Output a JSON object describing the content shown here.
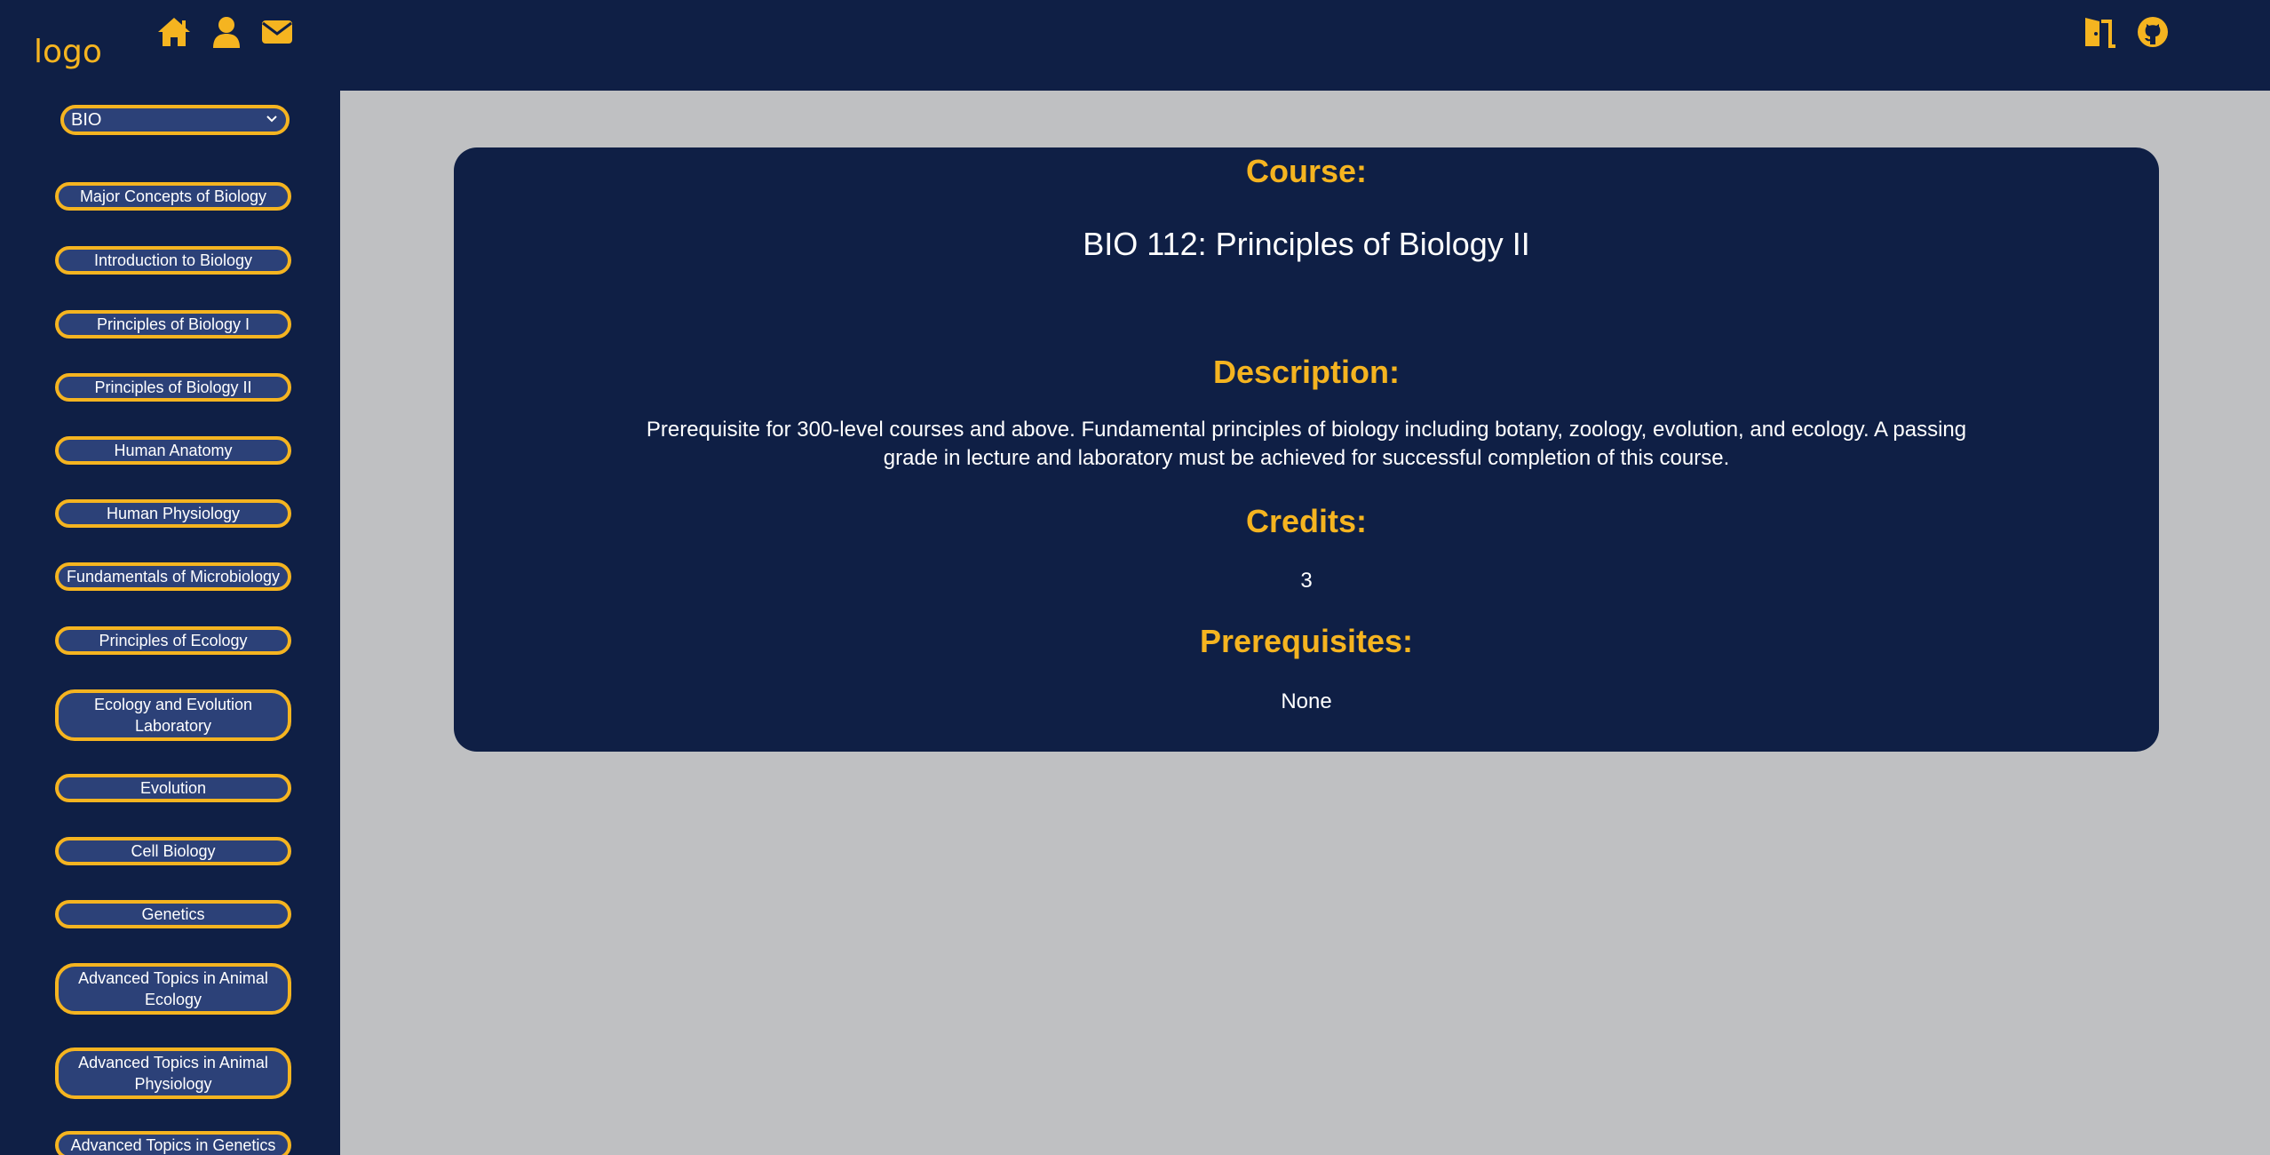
{
  "header": {
    "logo": "logo",
    "icons": [
      "home-icon",
      "user-icon",
      "envelope-icon",
      "door-exit-icon",
      "github-icon"
    ]
  },
  "sidebar": {
    "select_value": "BIO",
    "courses": [
      "Major Concepts of Biology",
      "Introduction to Biology",
      "Principles of Biology I",
      "Principles of Biology II",
      "Human Anatomy",
      "Human Physiology",
      "Fundamentals of Microbiology",
      "Principles of Ecology",
      "Ecology and Evolution Laboratory",
      "Evolution",
      "Cell Biology",
      "Genetics",
      "Advanced Topics in Animal Ecology",
      "Advanced Topics in Animal Physiology",
      "Advanced Topics in Genetics"
    ]
  },
  "course": {
    "course_heading": "Course:",
    "course_name": "BIO 112: Principles of Biology II",
    "description_heading": "Description:",
    "description": "Prerequisite for 300-level courses and above. Fundamental principles of biology including botany, zoology, evolution, and ecology. A passing grade in lecture and laboratory must be achieved for successful completion of this course.",
    "credits_heading": "Credits:",
    "credits": "3",
    "prerequisites_heading": "Prerequisites:",
    "prerequisites": "None"
  },
  "colors": {
    "navy": "#0f1f45",
    "accent": "#f5b420",
    "button_fill": "#2c4178",
    "content_bg": "#bfc0c2"
  }
}
